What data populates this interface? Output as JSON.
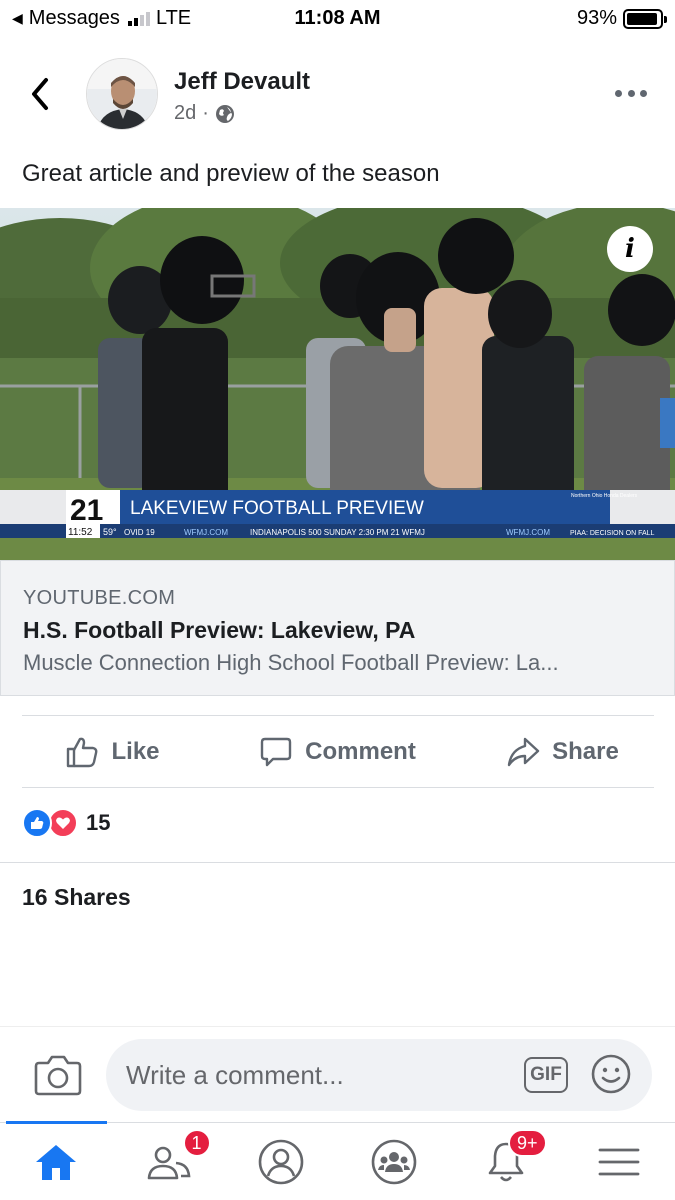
{
  "status_bar": {
    "back_app": "Messages",
    "network": "LTE",
    "time": "11:08 AM",
    "battery": "93%",
    "battery_level": 0.93
  },
  "post": {
    "author": "Jeff Devault",
    "time_ago": "2d",
    "separator": "·",
    "text": "Great article and preview of the season"
  },
  "link": {
    "domain": "YOUTUBE.COM",
    "title": "H.S. Football Preview: Lakeview, PA",
    "description": "Muscle Connection High School Football Preview: La...",
    "info_label": "i",
    "overlay": {
      "channel": "21",
      "headline": "LAKEVIEW FOOTBALL PREVIEW",
      "ticker_time": "11:52",
      "ticker_temp": "59°",
      "ticker_1": "OVID 19",
      "ticker_2": "WFMJ.COM",
      "ticker_3": "INDIANAPOLIS 500 SUNDAY  2:30 PM  21 WFMJ",
      "ticker_4": "WFMJ.COM",
      "ticker_5": "PIAA: DECISION ON FALL",
      "sponsor": "Northern Ohio Honda Dealers"
    }
  },
  "actions": {
    "like": "Like",
    "comment": "Comment",
    "share": "Share"
  },
  "reactions": {
    "count": "15"
  },
  "shares": "16 Shares",
  "composer": {
    "placeholder": "Write a comment...",
    "gif": "GIF"
  },
  "tabbar": {
    "friends_badge": "1",
    "notifications_badge": "9+"
  },
  "colors": {
    "accent": "#1877f2",
    "badge": "#e41e3f",
    "love": "#f33e58"
  }
}
